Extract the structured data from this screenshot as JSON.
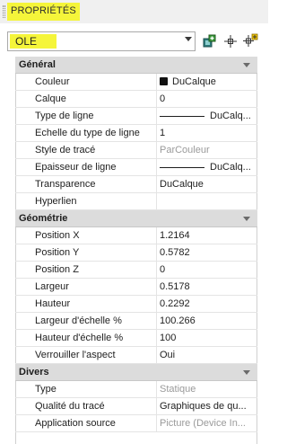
{
  "title": "PROPRIÉTÉS",
  "selector": {
    "value": "OLE"
  },
  "toolbar": {
    "quick_select_icon": "quick-select-icon",
    "select_objects_icon": "select-objects-icon",
    "toggle_pickadd_icon": "toggle-pickadd-icon"
  },
  "categories": {
    "general": {
      "label": "Général",
      "rows": {
        "couleur": {
          "name": "Couleur",
          "value": "DuCalque"
        },
        "calque": {
          "name": "Calque",
          "value": "0"
        },
        "type_ligne": {
          "name": "Type de ligne",
          "value": "DuCalq..."
        },
        "echelle_type_ligne": {
          "name": "Echelle du type de ligne",
          "value": "1"
        },
        "style_trace": {
          "name": "Style de tracé",
          "value": "ParCouleur"
        },
        "epaisseur": {
          "name": "Epaisseur de ligne",
          "value": "DuCalq..."
        },
        "transparence": {
          "name": "Transparence",
          "value": "DuCalque"
        },
        "hyperlien": {
          "name": "Hyperlien",
          "value": ""
        }
      }
    },
    "geometrie": {
      "label": "Géométrie",
      "rows": {
        "position_x": {
          "name": "Position X",
          "value": "1.2164"
        },
        "position_y": {
          "name": "Position Y",
          "value": "0.5782"
        },
        "position_z": {
          "name": "Position Z",
          "value": "0"
        },
        "largeur": {
          "name": "Largeur",
          "value": "0.5178"
        },
        "hauteur": {
          "name": "Hauteur",
          "value": "0.2292"
        },
        "largeur_echelle": {
          "name": "Largeur d'échelle %",
          "value": "100.266"
        },
        "hauteur_echelle": {
          "name": "Hauteur d'échelle %",
          "value": "100"
        },
        "verrouiller": {
          "name": "Verrouiller l'aspect",
          "value": "Oui"
        }
      }
    },
    "divers": {
      "label": "Divers",
      "rows": {
        "type": {
          "name": "Type",
          "value": "Statique"
        },
        "qualite": {
          "name": "Qualité du tracé",
          "value": "Graphiques de qu..."
        },
        "application": {
          "name": "Application source",
          "value": "Picture (Device In..."
        }
      }
    }
  },
  "colors": {
    "highlight": "#f5f53a",
    "category_bg": "#dcdcdc",
    "disabled_text": "#9a9a9a"
  }
}
